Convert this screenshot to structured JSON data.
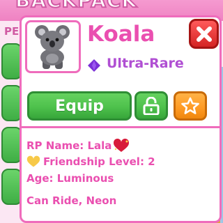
{
  "background": {
    "window_title": "BACKPACK",
    "tab_label": "PE"
  },
  "pet": {
    "name": "Koala",
    "rarity": "Ultra-Rare",
    "rarity_color": "#b04fd3",
    "image_icon": "koala-pet-icon"
  },
  "actions": {
    "close_icon": "close-x-icon",
    "equip_label": "Equip",
    "lock_icon": "unlocked-padlock-icon",
    "favorite_icon": "star-outline-icon"
  },
  "details": {
    "rp_name_label": "RP Name: Lala",
    "friendship_label": "Friendship Level: 2",
    "age_label": "Age: Luminous",
    "traits_label": "Can Ride, Neon"
  },
  "colors": {
    "accent_pink": "#ea4fb0",
    "border_pink": "#ef6cbc",
    "equip_green": "#4ec14c",
    "favorite_orange": "#ff9c26",
    "close_red": "#e23434"
  }
}
